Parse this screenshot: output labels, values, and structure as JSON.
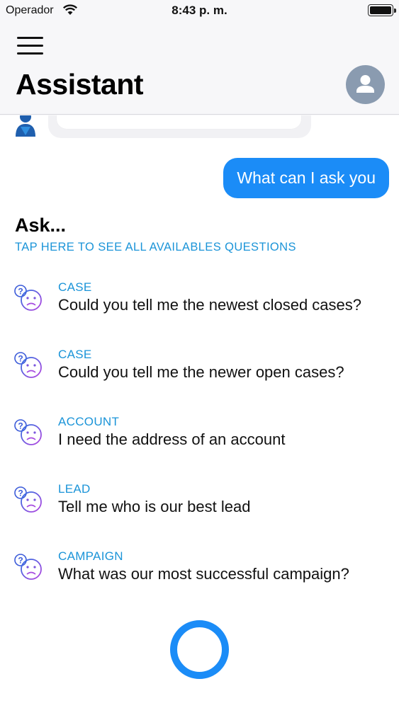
{
  "status_bar": {
    "carrier": "Operador",
    "time": "8:43 p. m.",
    "wifi_icon": "wifi-icon",
    "battery_level": 1.0
  },
  "header": {
    "title": "Assistant",
    "menu_icon": "hamburger-menu-icon",
    "profile_icon": "user-profile-icon"
  },
  "chat": {
    "user_message": "What can I ask you"
  },
  "suggestions": {
    "title": "Ask...",
    "link": "TAP HERE TO SEE ALL AVAILABLES QUESTIONS",
    "items": [
      {
        "category": "CASE",
        "question": "Could you tell me the newest closed cases?"
      },
      {
        "category": "CASE",
        "question": "Could you tell me the newer open cases?"
      },
      {
        "category": "ACCOUNT",
        "question": "I need the address of an account"
      },
      {
        "category": "LEAD",
        "question": "Tell me who is our best lead"
      },
      {
        "category": "CAMPAIGN",
        "question": "What was our most successful campaign?"
      }
    ]
  },
  "colors": {
    "accent": "#1b8cf7",
    "link": "#1b94d8",
    "avatar_bg": "#8a9bb0"
  }
}
